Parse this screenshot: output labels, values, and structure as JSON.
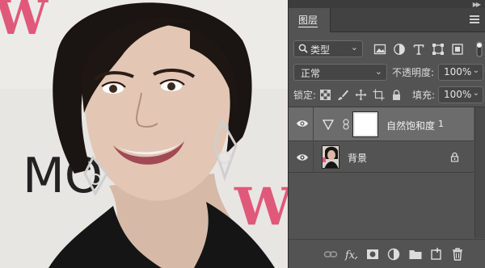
{
  "panel": {
    "tab_label": "图层",
    "filter": {
      "label": "类型",
      "chevron": "⌄"
    },
    "blend_mode": "正常",
    "opacity_label": "不透明度:",
    "opacity_value": "100%",
    "lock_label": "锁定:",
    "fill_label": "填充:",
    "fill_value": "100%"
  },
  "layers": [
    {
      "name": "自然饱和度",
      "suffix": "1",
      "type": "adjustment-vibrance",
      "visible": true,
      "selected": true
    },
    {
      "name": "背景",
      "type": "image",
      "visible": true,
      "locked": true
    }
  ],
  "icons": {
    "filter_kinds": [
      "pixel-layer-filter-icon",
      "adjustment-filter-icon",
      "type-filter-icon",
      "shape-filter-icon",
      "smart-object-filter-icon"
    ],
    "lock_kinds": [
      "lock-transparency-icon",
      "lock-pixels-icon",
      "lock-position-icon",
      "lock-artboard-icon",
      "lock-all-icon"
    ],
    "bottom_bar": [
      "link-layers-icon",
      "layer-style-icon",
      "add-mask-icon",
      "new-adjustment-icon",
      "new-group-icon",
      "new-layer-icon",
      "delete-layer-icon"
    ]
  },
  "colors": {
    "panel_bg": "#535353",
    "selected_row": "#6c6c6c",
    "tab_bar": "#424242",
    "canvas_text_pink": "#e0597a"
  },
  "canvas": {
    "background_letters_pink_1": "W",
    "background_letters_dark": "MO",
    "background_letters_pink_2": "W"
  }
}
